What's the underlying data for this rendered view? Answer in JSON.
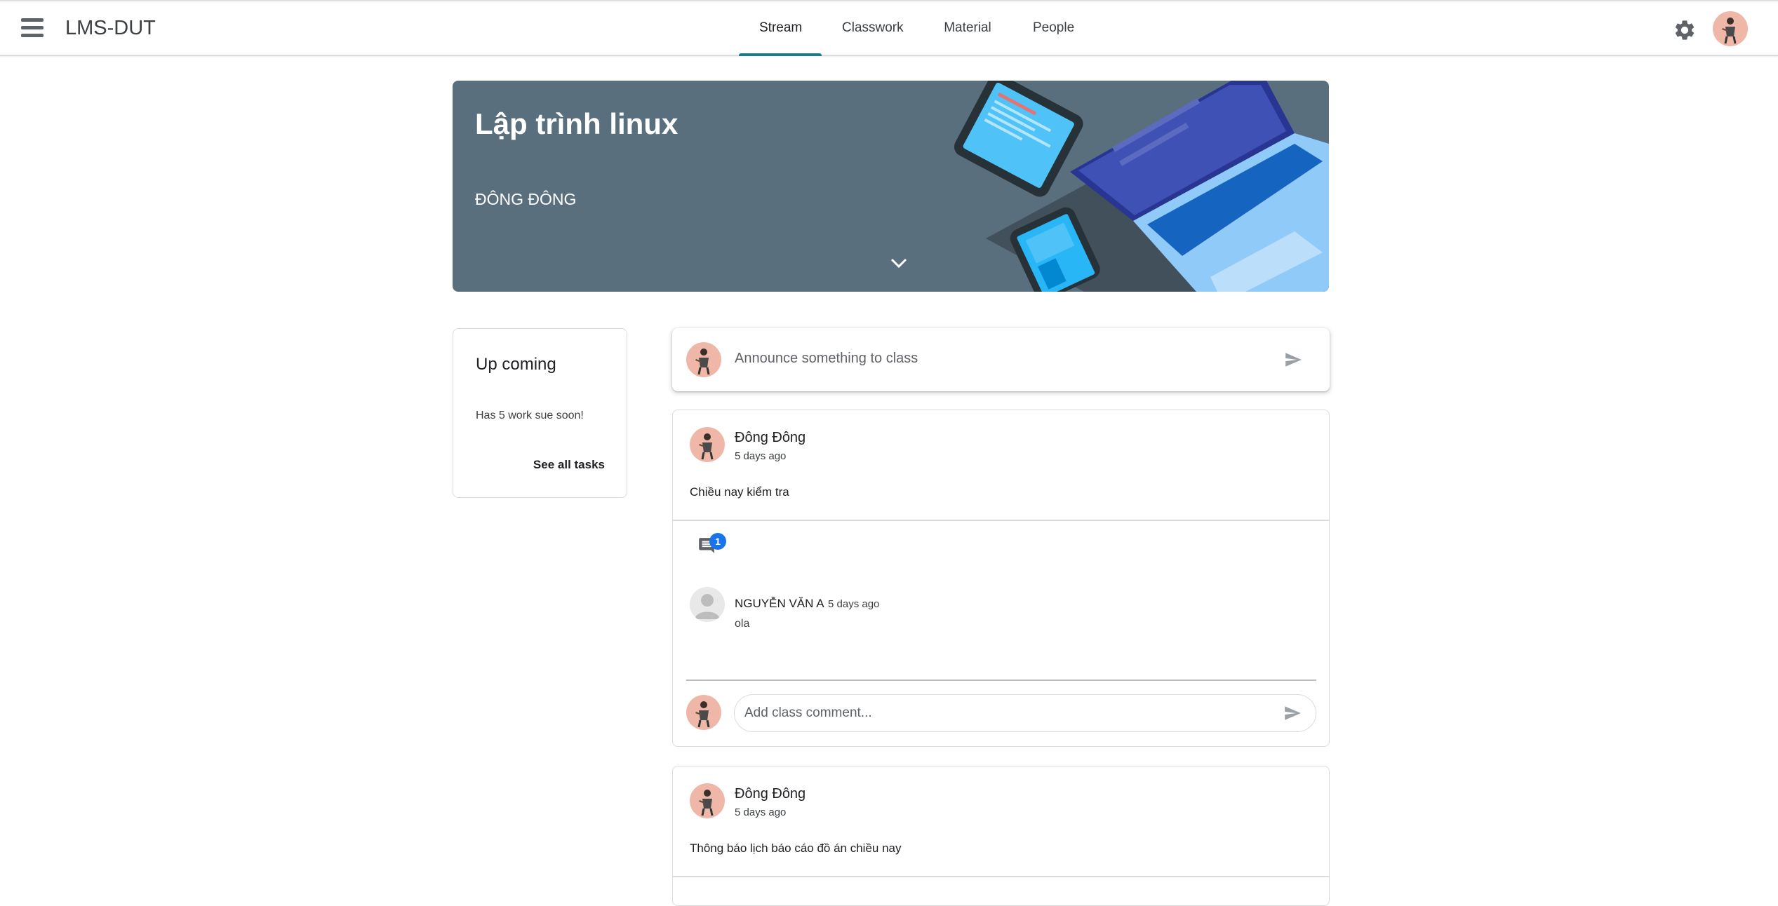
{
  "app": {
    "title": "LMS-DUT"
  },
  "tabs": [
    {
      "label": "Stream",
      "active": true
    },
    {
      "label": "Classwork"
    },
    {
      "label": "Material"
    },
    {
      "label": "People"
    }
  ],
  "icons": {
    "menu": "menu-icon",
    "settings": "gear-icon",
    "expand": "chevron-down-icon",
    "send": "send-icon",
    "comments": "comment-icon"
  },
  "colors": {
    "accent": "#1e7b85",
    "banner": "#5a6f7d",
    "badge": "#1a73e8",
    "avatar_bg": "#efb7a7"
  },
  "banner": {
    "class_name": "Lập trình linux",
    "teacher": "ĐÔNG ĐÔNG"
  },
  "upcoming": {
    "title": "Up coming",
    "text": "Has 5 work sue soon!",
    "link": "See all tasks"
  },
  "announce": {
    "placeholder": "Announce something to class"
  },
  "posts": [
    {
      "author": "Đông Đông",
      "time": "5 days ago",
      "body": "Chiều nay kiểm tra",
      "comment_count": "1",
      "comments": [
        {
          "author": "NGUYỄN VĂN A",
          "time": "5 days ago",
          "text": "ola"
        }
      ],
      "comment_placeholder": "Add class comment..."
    },
    {
      "author": "Đông Đông",
      "time": "5 days ago",
      "body": "Thông báo lịch báo cáo đồ án chiều nay"
    }
  ]
}
